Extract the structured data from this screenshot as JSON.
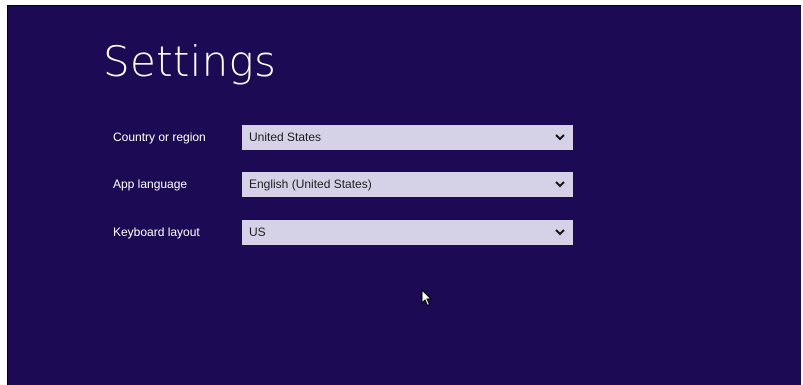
{
  "page": {
    "title": "Settings"
  },
  "settings": [
    {
      "label": "Country or region",
      "value": "United States"
    },
    {
      "label": "App language",
      "value": "English (United States)"
    },
    {
      "label": "Keyboard layout",
      "value": "US"
    }
  ],
  "icons": {
    "dropdown": "chevron-down-icon",
    "pointer": "mouse-cursor-icon"
  },
  "colors": {
    "background": "#1c0b54",
    "dropdown_fill": "#d5d1e6",
    "text": "#ffffff"
  }
}
